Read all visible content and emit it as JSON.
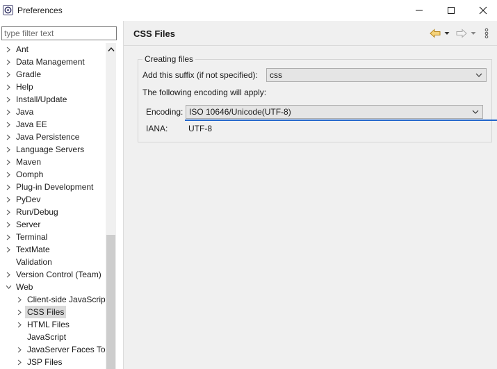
{
  "window": {
    "title": "Preferences",
    "minimize_glyph": "—",
    "maximize_glyph": "☐",
    "close_glyph": "✕"
  },
  "filter": {
    "placeholder": "type filter text",
    "value": ""
  },
  "tree": {
    "items": [
      {
        "label": "Ant",
        "expandable": true,
        "expanded": false,
        "level": 0
      },
      {
        "label": "Data Management",
        "expandable": true,
        "expanded": false,
        "level": 0
      },
      {
        "label": "Gradle",
        "expandable": true,
        "expanded": false,
        "level": 0
      },
      {
        "label": "Help",
        "expandable": true,
        "expanded": false,
        "level": 0
      },
      {
        "label": "Install/Update",
        "expandable": true,
        "expanded": false,
        "level": 0
      },
      {
        "label": "Java",
        "expandable": true,
        "expanded": false,
        "level": 0
      },
      {
        "label": "Java EE",
        "expandable": true,
        "expanded": false,
        "level": 0
      },
      {
        "label": "Java Persistence",
        "expandable": true,
        "expanded": false,
        "level": 0
      },
      {
        "label": "Language Servers",
        "expandable": true,
        "expanded": false,
        "level": 0
      },
      {
        "label": "Maven",
        "expandable": true,
        "expanded": false,
        "level": 0
      },
      {
        "label": "Oomph",
        "expandable": true,
        "expanded": false,
        "level": 0
      },
      {
        "label": "Plug-in Development",
        "expandable": true,
        "expanded": false,
        "level": 0
      },
      {
        "label": "PyDev",
        "expandable": true,
        "expanded": false,
        "level": 0
      },
      {
        "label": "Run/Debug",
        "expandable": true,
        "expanded": false,
        "level": 0
      },
      {
        "label": "Server",
        "expandable": true,
        "expanded": false,
        "level": 0
      },
      {
        "label": "Terminal",
        "expandable": true,
        "expanded": false,
        "level": 0
      },
      {
        "label": "TextMate",
        "expandable": true,
        "expanded": false,
        "level": 0
      },
      {
        "label": "Validation",
        "expandable": false,
        "expanded": false,
        "level": 0
      },
      {
        "label": "Version Control (Team)",
        "expandable": true,
        "expanded": false,
        "level": 0
      },
      {
        "label": "Web",
        "expandable": true,
        "expanded": true,
        "level": 0
      },
      {
        "label": "Client-side JavaScript",
        "expandable": true,
        "expanded": false,
        "level": 1
      },
      {
        "label": "CSS Files",
        "expandable": true,
        "expanded": false,
        "level": 1,
        "selected": true
      },
      {
        "label": "HTML Files",
        "expandable": true,
        "expanded": false,
        "level": 1
      },
      {
        "label": "JavaScript",
        "expandable": false,
        "expanded": false,
        "level": 1
      },
      {
        "label": "JavaServer Faces Tools",
        "expandable": true,
        "expanded": false,
        "level": 1
      },
      {
        "label": "JSP Files",
        "expandable": true,
        "expanded": false,
        "level": 1
      }
    ]
  },
  "page": {
    "title": "CSS Files",
    "group_title": "Creating files",
    "suffix_label": "Add this suffix (if not specified):",
    "suffix_value": "css",
    "encoding_note": "The following encoding will apply:",
    "encoding_label": "Encoding:",
    "encoding_value": "ISO 10646/Unicode(UTF-8)",
    "iana_label": "IANA:",
    "iana_value": "UTF-8"
  },
  "colors": {
    "accent_focus": "#2266cc",
    "selection": "#d9d9d9",
    "back_arrow": "#e8b04a"
  }
}
